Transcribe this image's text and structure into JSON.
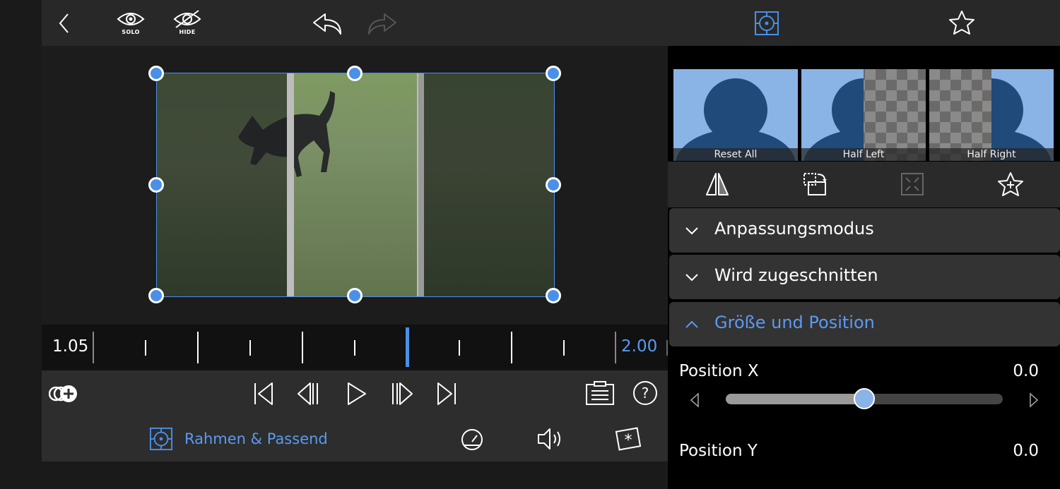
{
  "topbar": {
    "solo_label": "SOLO",
    "hide_label": "HIDE"
  },
  "timeline": {
    "start_value": "1.05",
    "end_value": "2.00"
  },
  "bottombar": {
    "mode_label": "Rahmen & Passend"
  },
  "presets": [
    {
      "label": "Reset All"
    },
    {
      "label": "Half Left"
    },
    {
      "label": "Half Right"
    }
  ],
  "sections": [
    {
      "label": "Anpassungsmodus",
      "expanded": false
    },
    {
      "label": "Wird zugeschnitten",
      "expanded": false
    },
    {
      "label": "Größe und Position",
      "expanded": true
    }
  ],
  "properties": {
    "position_x": {
      "label": "Position X",
      "value": "0.0",
      "slider_fraction": 0.5
    },
    "position_y": {
      "label": "Position Y",
      "value": "0.0"
    }
  },
  "colors": {
    "accent": "#4a90e8",
    "accent_text": "#5b9af0",
    "panel": "#333333",
    "bar": "#2d2d2d"
  },
  "icons": [
    "back-chevron-icon",
    "eye-icon",
    "eye-off-icon",
    "undo-icon",
    "redo-icon",
    "frame-fit-icon",
    "star-icon",
    "flip-icon",
    "rotate-icon",
    "fit-frame-icon",
    "star-plus-icon",
    "add-clip-icon",
    "skip-start-icon",
    "step-back-icon",
    "play-icon",
    "step-forward-icon",
    "skip-end-icon",
    "notes-icon",
    "help-icon",
    "speed-icon",
    "volume-icon",
    "effects-icon"
  ]
}
